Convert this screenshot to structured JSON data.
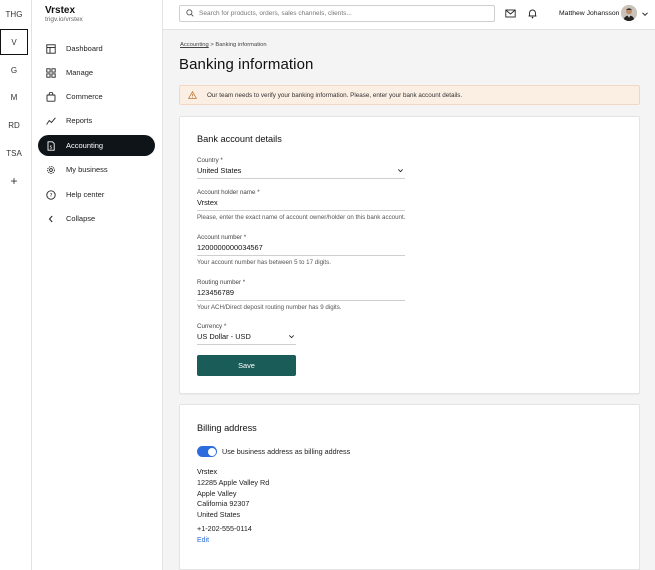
{
  "workspaces": [
    "THG",
    "V",
    "G",
    "M",
    "RD",
    "TSA"
  ],
  "workspace_add": "+",
  "brand": {
    "name": "Vrstex",
    "url": "trigv.io/vrstex"
  },
  "nav": [
    {
      "label": "Dashboard",
      "icon": "dashboard-icon"
    },
    {
      "label": "Manage",
      "icon": "manage-icon"
    },
    {
      "label": "Commerce",
      "icon": "commerce-icon"
    },
    {
      "label": "Reports",
      "icon": "reports-icon"
    },
    {
      "label": "Accounting",
      "icon": "accounting-icon",
      "active": true
    },
    {
      "label": "My business",
      "icon": "gear-icon"
    },
    {
      "label": "Help center",
      "icon": "help-icon"
    },
    {
      "label": "Collapse",
      "icon": "chevron-left-icon"
    }
  ],
  "search": {
    "placeholder": "Search for products, orders, sales channels, clients..."
  },
  "user": {
    "name": "Matthew Johansson"
  },
  "breadcrumb": {
    "parent": "Accounting",
    "separator": ">",
    "current": "Banking information"
  },
  "page_title": "Banking information",
  "alert": {
    "text": "Our team needs to verify your banking information. Please, enter your bank account details."
  },
  "bank_card": {
    "title": "Bank account details",
    "country": {
      "label": "Country *",
      "value": "United States"
    },
    "holder": {
      "label": "Account holder name *",
      "value": "Vrstex",
      "helper": "Please, enter the exact name of account owner/holder on this bank account."
    },
    "account": {
      "label": "Account number *",
      "value": "1200000000034567",
      "helper": "Your account number has between 5 to 17 digits."
    },
    "routing": {
      "label": "Routing number *",
      "value": "123456789",
      "helper": "Your ACH/Direct deposit routing number has 9 digits."
    },
    "currency": {
      "label": "Currency *",
      "value": "US Dollar - USD"
    },
    "save_label": "Save"
  },
  "billing_card": {
    "title": "Billing address",
    "toggle_label": "Use business address as billing address",
    "address": [
      "Vrstex",
      "12285 Apple Valley Rd",
      "Apple Valley",
      "California 92307",
      "United States"
    ],
    "phone": "+1-202-555-0114",
    "edit_label": "Edit"
  },
  "colors": {
    "primary": "#1a5c57",
    "active_nav": "#0f1419",
    "toggle": "#2d6cdf",
    "alert_bg": "#fbeee3",
    "link": "#2a6bd6"
  }
}
